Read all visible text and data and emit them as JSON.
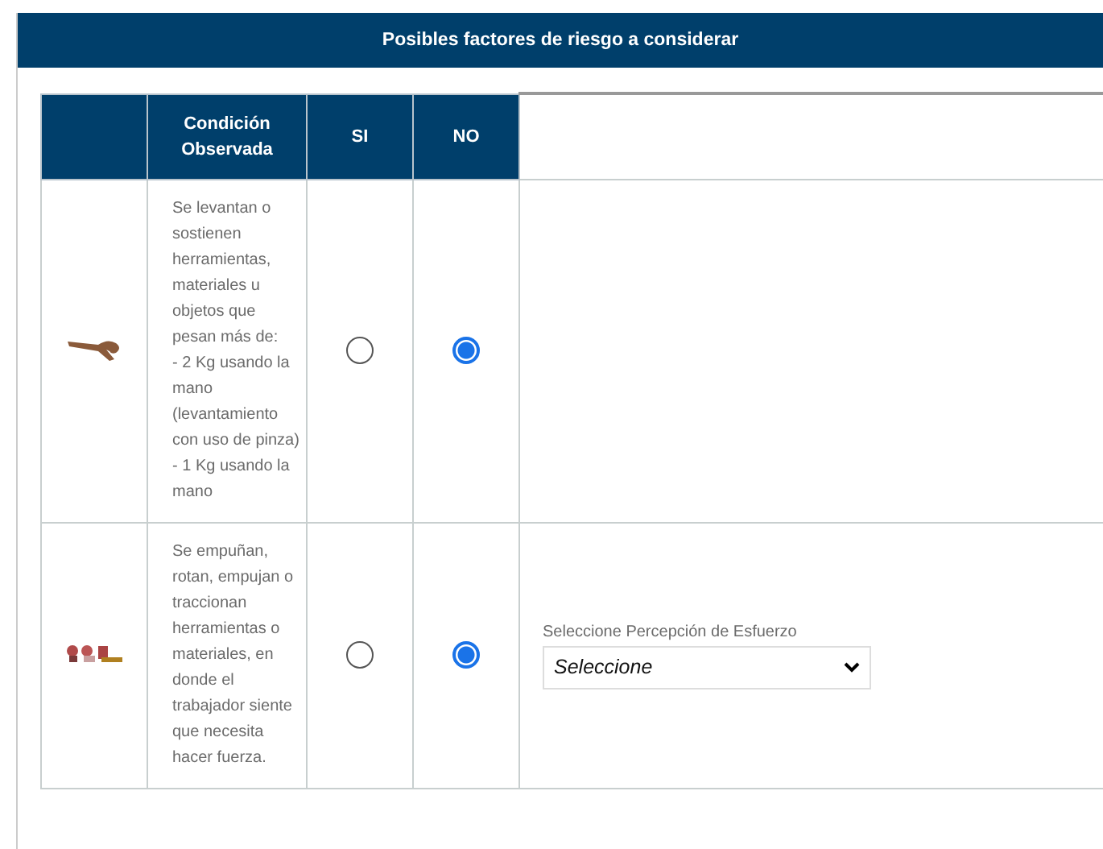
{
  "panel": {
    "title": "Posibles factores de riesgo a considerar"
  },
  "table": {
    "columns": [
      "",
      "Condición Observada",
      "SI",
      "NO"
    ],
    "rows": [
      {
        "kind": "pinch",
        "condition": "Se levantan o sostienen herramientas, materiales u objetos que pesan más de:\n- 2 Kg usando la mano (levantamiento con uso de pinza)\n- 1 Kg usando la mano",
        "si": {
          "selected": false
        },
        "no": {
          "selected": true
        }
      },
      {
        "kind": "grip",
        "condition": "Se empuñan, rotan, empujan o traccionan herramientas o materiales, en donde el trabajador siente que necesita hacer fuerza.",
        "si": {
          "selected": false
        },
        "no": {
          "selected": true
        },
        "effort": {
          "label": "Seleccione Percepción de Esfuerzo",
          "value": "Seleccione"
        }
      }
    ]
  }
}
